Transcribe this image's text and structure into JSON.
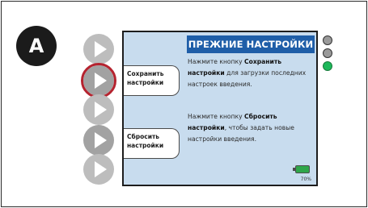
{
  "step": {
    "letter": "A"
  },
  "screen": {
    "title": "ПРЕЖНИЕ НАСТРОЙКИ",
    "soft_key_1": {
      "line1": "Сохранить",
      "line2": "настройки"
    },
    "soft_key_2": {
      "line1": "Сбросить",
      "line2": "настройки"
    },
    "text_1": {
      "part1": "Нажмите кнопку ",
      "bold1": "Сохранить настройки",
      "part2": " для загрузки последних настроек введения."
    },
    "text_2": {
      "part1": "Нажмите кнопку ",
      "bold1": "Сбросить настройки",
      "part2": ", чтобы задать новые настройки введения."
    },
    "battery": {
      "percent_label": "70%",
      "color": "#2fa64a"
    }
  },
  "side_buttons": {
    "count": 5,
    "highlighted_index": 1,
    "highlight_color": "#b5232f"
  },
  "indicator_lights": {
    "states": [
      "off",
      "off",
      "green"
    ],
    "green_color": "#1db85a"
  }
}
